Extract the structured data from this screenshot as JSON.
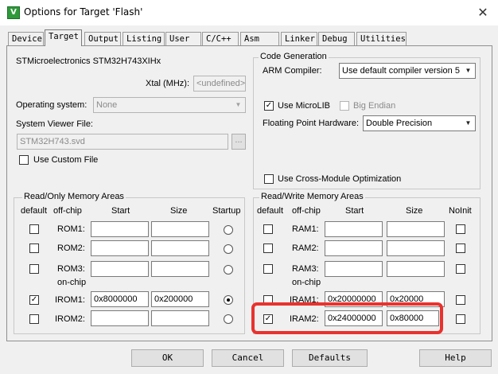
{
  "window": {
    "title": "Options for Target 'Flash'",
    "icon_letter": "V",
    "close_glyph": "✕"
  },
  "tabs": [
    "Device",
    "Target",
    "Output",
    "Listing",
    "User",
    "C/C++",
    "Asm",
    "Linker",
    "Debug",
    "Utilities"
  ],
  "active_tab": "Target",
  "target": {
    "device_name": "STMicroelectronics STM32H743XIHx",
    "xtal_label": "Xtal (MHz):",
    "xtal_value": "<undefined>",
    "os_label": "Operating system:",
    "os_value": "None",
    "svd_label": "System Viewer File:",
    "svd_value": "STM32H743.svd",
    "browse_label": "...",
    "custom_file_label": "Use Custom File",
    "custom_file_checked": false
  },
  "codegen": {
    "title": "Code Generation",
    "compiler_label": "ARM Compiler:",
    "compiler_value": "Use default compiler version 5",
    "microlib_label": "Use MicroLIB",
    "microlib_checked": true,
    "big_endian_label": "Big Endian",
    "big_endian_checked": false,
    "fpu_label": "Floating Point Hardware:",
    "fpu_value": "Double Precision",
    "cross_module_label": "Use Cross-Module Optimization",
    "cross_module_checked": false
  },
  "rom": {
    "title": "Read/Only Memory Areas",
    "headers": {
      "default": "default",
      "offchip": "off-chip",
      "start": "Start",
      "size": "Size",
      "extra": "Startup"
    },
    "onchip_label": "on-chip",
    "rows": [
      {
        "name": "ROM1:",
        "checked": false,
        "start": "",
        "size": "",
        "selected": false
      },
      {
        "name": "ROM2:",
        "checked": false,
        "start": "",
        "size": "",
        "selected": false
      },
      {
        "name": "ROM3:",
        "checked": false,
        "start": "",
        "size": "",
        "selected": false
      },
      {
        "name": "IROM1:",
        "checked": true,
        "start": "0x8000000",
        "size": "0x200000",
        "selected": true
      },
      {
        "name": "IROM2:",
        "checked": false,
        "start": "",
        "size": "",
        "selected": false
      }
    ]
  },
  "ram": {
    "title": "Read/Write Memory Areas",
    "headers": {
      "default": "default",
      "offchip": "off-chip",
      "start": "Start",
      "size": "Size",
      "extra": "NoInit"
    },
    "onchip_label": "on-chip",
    "rows": [
      {
        "name": "RAM1:",
        "checked": false,
        "start": "",
        "size": "",
        "noinit": false
      },
      {
        "name": "RAM2:",
        "checked": false,
        "start": "",
        "size": "",
        "noinit": false
      },
      {
        "name": "RAM3:",
        "checked": false,
        "start": "",
        "size": "",
        "noinit": false
      },
      {
        "name": "IRAM1:",
        "checked": false,
        "start": "0x20000000",
        "size": "0x20000",
        "noinit": false
      },
      {
        "name": "IRAM2:",
        "checked": true,
        "start": "0x24000000",
        "size": "0x80000",
        "noinit": false
      }
    ]
  },
  "buttons": {
    "ok": "OK",
    "cancel": "Cancel",
    "defaults": "Defaults",
    "help": "Help"
  },
  "colors": {
    "highlight": "#e8322e",
    "window_bg": "#f0f0f0"
  }
}
